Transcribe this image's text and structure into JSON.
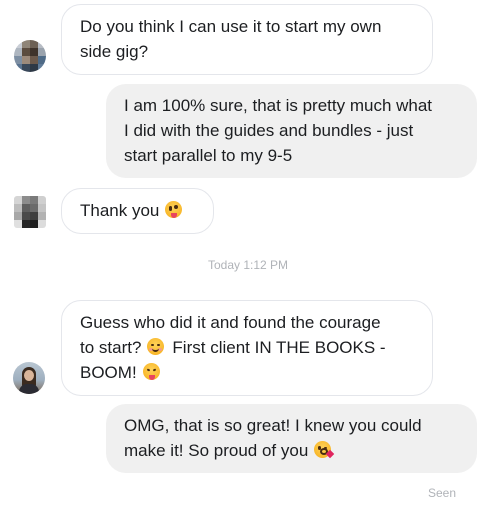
{
  "messages": [
    {
      "sender": "them",
      "lines": [
        "Do you think I can use it to start my own",
        "side gig?"
      ]
    },
    {
      "sender": "me",
      "lines": [
        "I am 100% sure, that is pretty much what",
        "I did with the guides and bundles - just",
        "start parallel to my 9-5"
      ]
    },
    {
      "sender": "them",
      "lines": [
        "Thank you"
      ],
      "emoji": "zany-face-emoji"
    },
    {
      "sender": "them",
      "lines": [
        "Guess who did it and found the courage",
        "to start?",
        "First client IN THE BOOKS -",
        "BOOM!"
      ],
      "emojis": [
        "smiling-face-emoji",
        "tongue-out-face-emoji"
      ]
    },
    {
      "sender": "me",
      "lines": [
        "OMG, that is so great! I knew you could",
        "make it! So proud of you"
      ],
      "emoji": "face-blowing-kiss-emoji"
    }
  ],
  "timestamp": "Today 1:12 PM",
  "status": "Seen",
  "colors": {
    "incoming_border": "#e4e6eb",
    "outgoing_bg": "#f0f0f0",
    "meta_text": "#b0b3b8"
  }
}
